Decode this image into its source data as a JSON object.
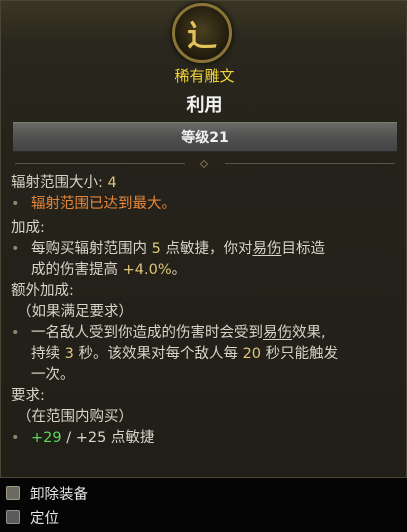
{
  "tooltip": {
    "rarity": "稀有雕文",
    "name": "利用",
    "level": "等级21",
    "emblem_glyph": "辶",
    "radius": {
      "label": "辐射范围大小: ",
      "value": "4",
      "note": "辐射范围已达到最大。"
    },
    "bonus": {
      "heading": "加成:",
      "text_1a": "每购买辐射范围内 ",
      "text_1b": "5",
      "text_1c": " 点敏捷，你对",
      "text_1d": "易伤",
      "text_1e": "目标造",
      "text_2a": "成的伤害提高 ",
      "text_2b": "+4.0%",
      "text_2c": "。"
    },
    "extra": {
      "heading": "额外加成:",
      "condition": "（如果满足要求）",
      "line_1a": "一名敌人受到你造成的伤害时会受到",
      "line_1b": "易伤",
      "line_1c": "效果,",
      "line_2a": "持续 ",
      "line_2b": "3",
      "line_2c": " 秒。该效果对每个敌人每 ",
      "line_2d": "20",
      "line_2e": " 秒只能触发",
      "line_3": "一次。"
    },
    "requirement": {
      "heading": "要求:",
      "condition": "（在范围内购买）",
      "current": "+29",
      "rest": " / +25 点敏捷"
    }
  },
  "actions": {
    "unequip": "卸除装备",
    "locate": "定位"
  }
}
